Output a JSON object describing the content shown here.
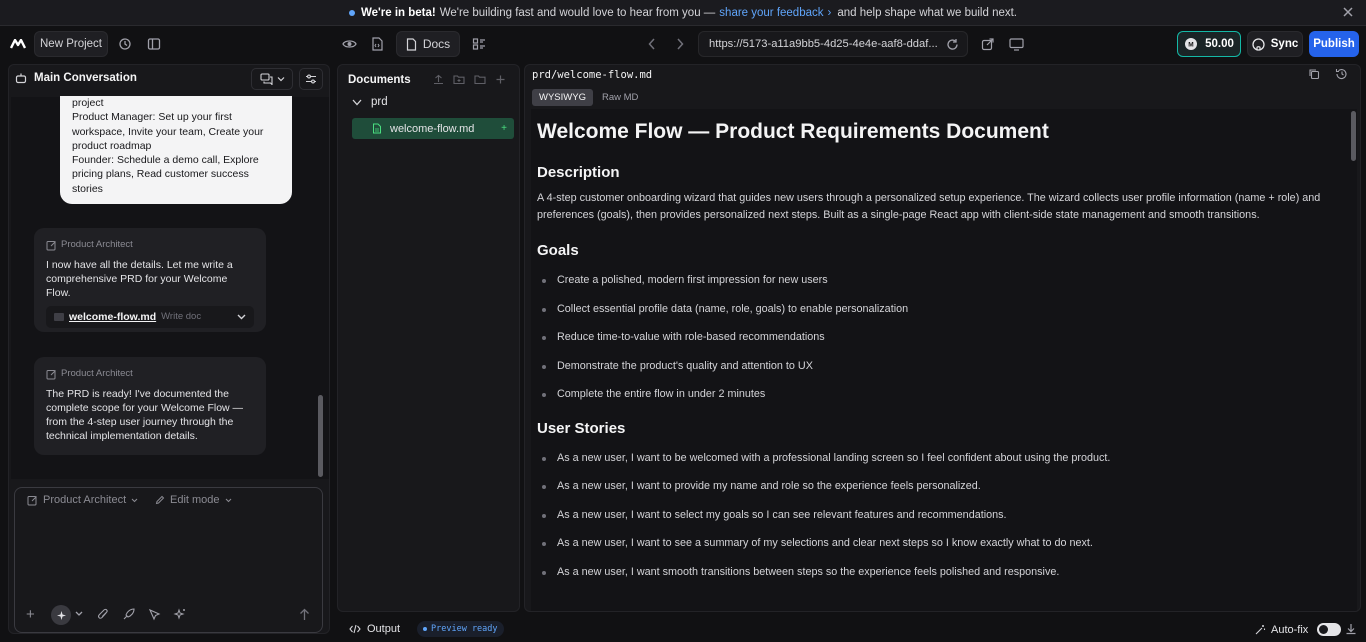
{
  "banner": {
    "lead": "We're in beta!",
    "text": "We're building fast and would love to hear from you —",
    "link": "share your feedback",
    "tail": "and help shape what we build next."
  },
  "topbar": {
    "project_name": "New Project",
    "docs_label": "Docs",
    "url": "https://5173-a11a9bb5-4d25-4e4e-aaf8-ddaf...",
    "credits": "50.00",
    "sync_label": "Sync",
    "publish_label": "Publish"
  },
  "conversation": {
    "title": "Main Conversation",
    "user_message": "project\n  Product Manager: Set up your first workspace, Invite your team, Create your product roadmap\n  Founder: Schedule a demo call, Explore pricing plans, Read customer success stories",
    "messages": [
      {
        "author": "Product Architect",
        "text": "I now have all the details. Let me write a comprehensive PRD for your Welcome Flow.",
        "file": "welcome-flow.md",
        "file_action": "Write doc"
      },
      {
        "author": "Product Architect",
        "text": "The PRD is ready! I've documented the complete scope for your Welcome Flow — from the 4-step user journey through the technical implementation details."
      }
    ],
    "composer": {
      "agent": "Product Architect",
      "mode": "Edit mode"
    }
  },
  "documents": {
    "title": "Documents",
    "folder": "prd",
    "file": "welcome-flow.md"
  },
  "editor": {
    "path": "prd/welcome-flow.md",
    "tabs": [
      "WYSIWYG",
      "Raw MD"
    ],
    "title": "Welcome Flow — Product Requirements Document",
    "sections": [
      {
        "heading": "Description",
        "paragraph": "A 4-step customer onboarding wizard that guides new users through a personalized setup experience. The wizard collects user profile information (name + role) and preferences (goals), then provides personalized next steps. Built as a single-page React app with client-side state management and smooth transitions."
      },
      {
        "heading": "Goals",
        "items": [
          "Create a polished, modern first impression for new users",
          "Collect essential profile data (name, role, goals) to enable personalization",
          "Reduce time-to-value with role-based recommendations",
          "Demonstrate the product's quality and attention to UX",
          "Complete the entire flow in under 2 minutes"
        ]
      },
      {
        "heading": "User Stories",
        "items": [
          "As a new user, I want to be welcomed with a professional landing screen so I feel confident about using the product.",
          "As a new user, I want to provide my name and role so the experience feels personalized.",
          "As a new user, I want to select my goals so I can see relevant features and recommendations.",
          "As a new user, I want to see a summary of my selections and clear next steps so I know exactly what to do next.",
          "As a new user, I want smooth transitions between steps so the experience feels polished and responsive."
        ]
      }
    ]
  },
  "statusbar": {
    "output_label": "Output",
    "preview_status": "Preview ready",
    "autofix_label": "Auto-fix"
  },
  "colors": {
    "publish": "#2563eb",
    "active_file": "#1f4d3a",
    "credits_border": "#14b8a6",
    "link": "#60a5fa"
  }
}
